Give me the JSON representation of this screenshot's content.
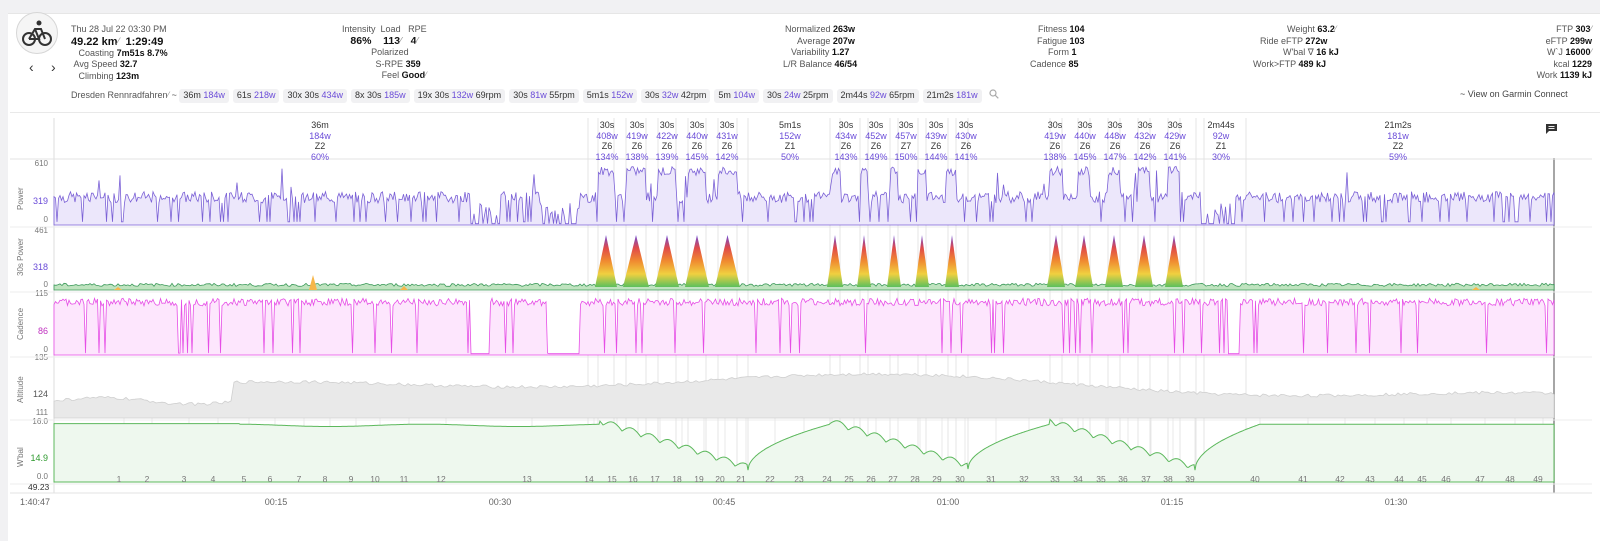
{
  "activity": {
    "date": "Thu 28 Jul 22",
    "time": "03:30 PM",
    "distance": "49.22 km",
    "duration": "1:29:49",
    "coasting_label": "Coasting",
    "coasting_value": "7m51s",
    "coasting_pct": "8.7%",
    "avg_speed_label": "Avg Speed",
    "avg_speed_value": "32.7",
    "climbing_label": "Climbing",
    "climbing_value": "123m"
  },
  "intensity": {
    "intensity_label": "Intensity",
    "intensity_value": "86%",
    "load_label": "Load",
    "load_value": "113",
    "rpe_label": "RPE",
    "rpe_value": "4",
    "polarized_label": "Polarized",
    "srpe_label": "S-RPE",
    "srpe_value": "359",
    "feel_label": "Feel",
    "feel_value": "Good"
  },
  "power_stats": {
    "normalized_label": "Normalized",
    "normalized_value": "263w",
    "average_label": "Average",
    "average_value": "207w",
    "variability_label": "Variability",
    "variability_value": "1.27",
    "lr_label": "L/R Balance",
    "lr_value": "46/54"
  },
  "fitness": {
    "fitness_label": "Fitness",
    "fitness_value": "104",
    "fatigue_label": "Fatigue",
    "fatigue_value": "103",
    "form_label": "Form",
    "form_value": "1",
    "cadence_label": "Cadence",
    "cadence_value": "85"
  },
  "athlete": {
    "weight_label": "Weight",
    "weight_value": "63.2",
    "ride_eftp_label": "Ride eFTP",
    "ride_eftp_value": "272w",
    "wbal_label": "W'bal ∇",
    "wbal_value": "16 kJ",
    "work_ftp_label": "Work>FTP",
    "work_ftp_value": "489 kJ"
  },
  "ftp": {
    "ftp_label": "FTP",
    "ftp_value": "303",
    "eftp_label": "eFTP",
    "eftp_value": "299w",
    "wj_label": "W`J",
    "wj_value": "16000",
    "kcal_label": "kcal",
    "kcal_value": "1229",
    "work_label": "Work",
    "work_value": "1139 kJ"
  },
  "tags_row": {
    "name": "Dresden Rennradfahren",
    "tilde": "~",
    "chips": [
      {
        "a": "36m",
        "b": "184w",
        "c": ""
      },
      {
        "a": "61s",
        "b": "218w",
        "c": ""
      },
      {
        "a": "30x 30s",
        "b": "434w",
        "c": ""
      },
      {
        "a": "8x 30s",
        "b": "185w",
        "c": ""
      },
      {
        "a": "19x 30s",
        "b": "132w",
        "c": "69rpm"
      },
      {
        "a": "30s",
        "b": "81w",
        "c": "55rpm"
      },
      {
        "a": "5m1s",
        "b": "152w",
        "c": ""
      },
      {
        "a": "30s",
        "b": "32w",
        "c": "42rpm"
      },
      {
        "a": "5m",
        "b": "104w",
        "c": ""
      },
      {
        "a": "30s",
        "b": "24w",
        "c": "25rpm"
      },
      {
        "a": "2m44s",
        "b": "92w",
        "c": "65rpm"
      },
      {
        "a": "21m2s",
        "b": "181w",
        "c": ""
      }
    ],
    "garmin_link": "~ View on Garmin Connect"
  },
  "intervals": [
    {
      "d": "36m",
      "w": "184w",
      "z": "Z2",
      "p": "60%"
    },
    {
      "d": "30s",
      "w": "408w",
      "z": "Z6",
      "p": "134%"
    },
    {
      "d": "30s",
      "w": "419w",
      "z": "Z6",
      "p": "138%"
    },
    {
      "d": "30s",
      "w": "422w",
      "z": "Z6",
      "p": "139%"
    },
    {
      "d": "30s",
      "w": "440w",
      "z": "Z6",
      "p": "145%"
    },
    {
      "d": "30s",
      "w": "431w",
      "z": "Z6",
      "p": "142%"
    },
    {
      "d": "5m1s",
      "w": "152w",
      "z": "Z1",
      "p": "50%"
    },
    {
      "d": "30s",
      "w": "434w",
      "z": "Z6",
      "p": "143%"
    },
    {
      "d": "30s",
      "w": "452w",
      "z": "Z6",
      "p": "149%"
    },
    {
      "d": "30s",
      "w": "457w",
      "z": "Z7",
      "p": "150%"
    },
    {
      "d": "30s",
      "w": "439w",
      "z": "Z6",
      "p": "144%"
    },
    {
      "d": "30s",
      "w": "430w",
      "z": "Z6",
      "p": "141%"
    },
    {
      "d": "30s",
      "w": "419w",
      "z": "Z6",
      "p": "138%"
    },
    {
      "d": "30s",
      "w": "440w",
      "z": "Z6",
      "p": "145%"
    },
    {
      "d": "30s",
      "w": "448w",
      "z": "Z6",
      "p": "147%"
    },
    {
      "d": "30s",
      "w": "432w",
      "z": "Z6",
      "p": "142%"
    },
    {
      "d": "30s",
      "w": "429w",
      "z": "Z6",
      "p": "141%"
    },
    {
      "d": "2m44s",
      "w": "92w",
      "z": "Z1",
      "p": "30%"
    },
    {
      "d": "21m2s",
      "w": "181w",
      "z": "Z2",
      "p": "59%"
    }
  ],
  "charts": {
    "power": {
      "label": "Power",
      "ticks": [
        "610",
        "319",
        "0"
      ]
    },
    "power30": {
      "label": "30s Power",
      "ticks": [
        "461",
        "318",
        "0"
      ]
    },
    "cadence": {
      "label": "Cadence",
      "ticks": [
        "115",
        "86",
        "0"
      ]
    },
    "altitude": {
      "label": "Altitude",
      "ticks": [
        "135",
        "124",
        "111"
      ]
    },
    "wbal": {
      "label": "W'bal",
      "ticks": [
        "16.0",
        "14.9",
        "0.0"
      ]
    }
  },
  "lap_axis": {
    "start": "49.23",
    "laps": [
      "1",
      "2",
      "3",
      "4",
      "5",
      "6",
      "7",
      "8",
      "9",
      "10",
      "11",
      "12",
      "13",
      "14",
      "15",
      "16",
      "17",
      "18",
      "19",
      "20",
      "21",
      "22",
      "23",
      "24",
      "25",
      "26",
      "27",
      "28",
      "29",
      "30",
      "31",
      "32",
      "33",
      "34",
      "35",
      "36",
      "37",
      "38",
      "39",
      "40",
      "41",
      "42",
      "43",
      "44",
      "45",
      "46",
      "47",
      "48",
      "49"
    ]
  },
  "time_axis": {
    "start": "1:40:47",
    "ticks": [
      "00:15",
      "00:30",
      "00:45",
      "01:00",
      "01:15",
      "01:30"
    ]
  },
  "colors": {
    "power": "#7b61d6",
    "cadence": "#e64ee6",
    "wbal": "#5cb85c",
    "altitude": "#c8c8c8"
  }
}
